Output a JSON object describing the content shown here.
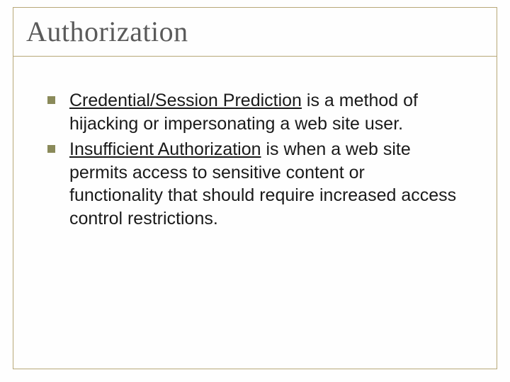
{
  "slide": {
    "title": "Authorization",
    "bullets": [
      {
        "term": "Credential/Session Prediction",
        "rest": " is a method of hijacking or impersonating a web site user."
      },
      {
        "term": "Insufficient Authorization",
        "rest": " is when a web site permits access to sensitive content or functionality that should require increased access control restrictions."
      }
    ]
  }
}
